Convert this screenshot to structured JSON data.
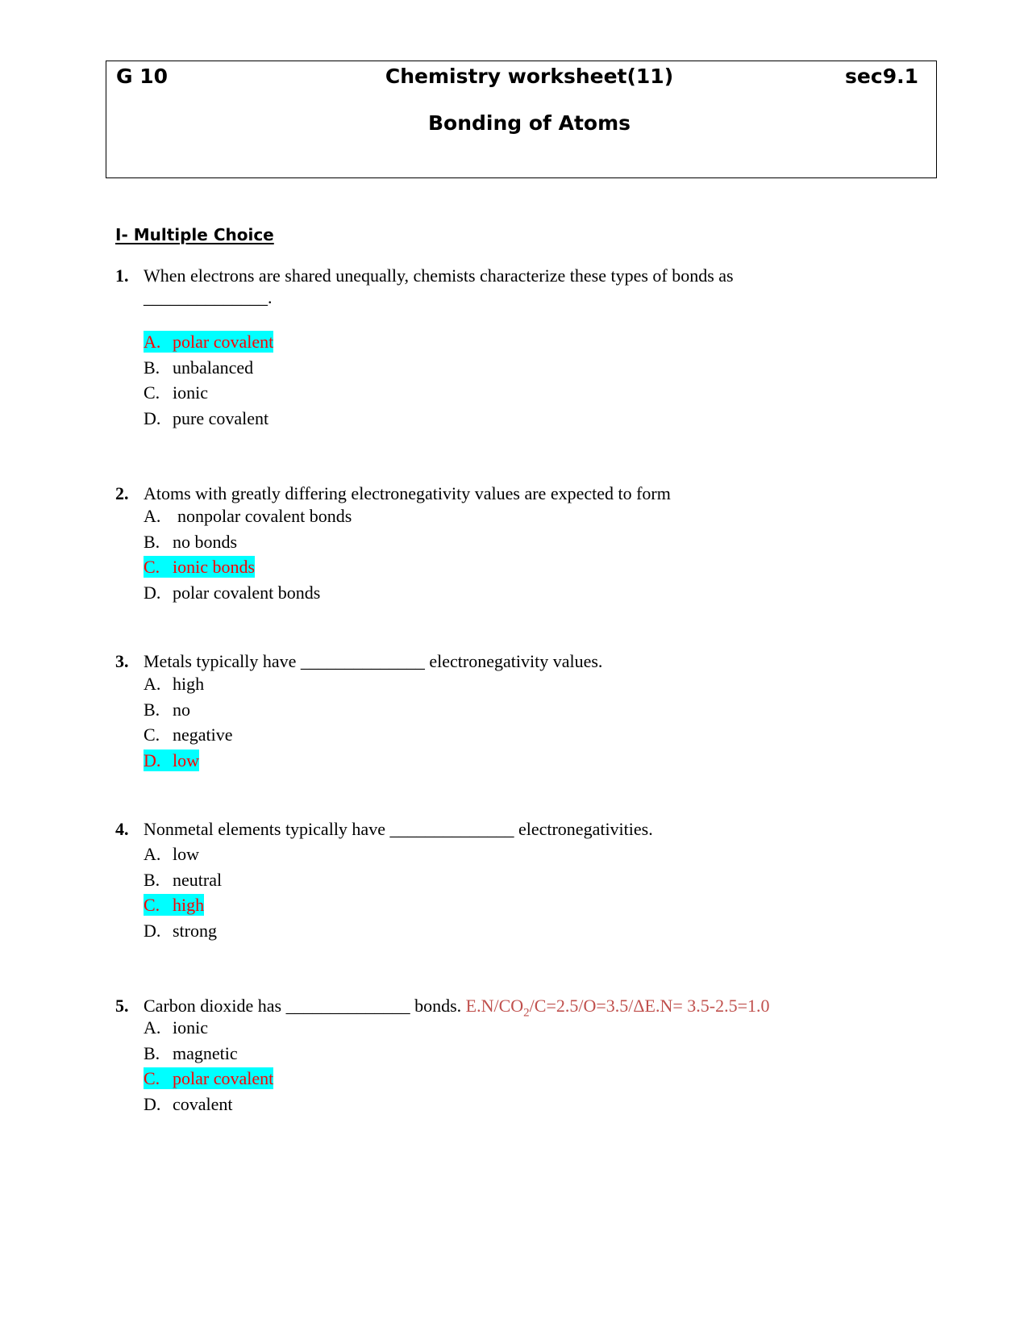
{
  "header": {
    "grade": "G 10",
    "title": "Chemistry worksheet(11)",
    "section": "sec9.1",
    "subtitle": "Bonding of Atoms"
  },
  "section_title": "I- Multiple Choice",
  "colors": {
    "highlight": "#00ffff",
    "answer_text": "#ff0000",
    "note_text": "#c0504d"
  },
  "questions": [
    {
      "number": "1.",
      "stem": "When electrons are shared unequally, chemists characterize these types of bonds as",
      "stem_continued": "______________.",
      "options": [
        {
          "letter": "A.",
          "text": "polar covalent",
          "correct": true
        },
        {
          "letter": "B.",
          "text": "unbalanced",
          "correct": false
        },
        {
          "letter": "C.",
          "text": "ionic",
          "correct": false
        },
        {
          "letter": "D.",
          "text": "pure covalent",
          "correct": false
        }
      ]
    },
    {
      "number": "2.",
      "stem": "Atoms with greatly differing electronegativity values are expected to form",
      "options": [
        {
          "letter": "A.",
          "text": "nonpolar covalent bonds",
          "correct": false
        },
        {
          "letter": "B.",
          "text": "no bonds",
          "correct": false
        },
        {
          "letter": "C.",
          "text": "ionic bonds",
          "correct": true
        },
        {
          "letter": "D.",
          "text": "polar covalent bonds",
          "correct": false
        }
      ]
    },
    {
      "number": "3.",
      "stem": "Metals typically have ______________ electronegativity values.",
      "options": [
        {
          "letter": "A.",
          "text": "high",
          "correct": false
        },
        {
          "letter": "B.",
          "text": "no",
          "correct": false
        },
        {
          "letter": "C.",
          "text": "negative",
          "correct": false
        },
        {
          "letter": "D.",
          "text": "low",
          "correct": true
        }
      ]
    },
    {
      "number": "4.",
      "stem": "Nonmetal elements typically have ______________ electronegativities.",
      "options": [
        {
          "letter": "A.",
          "text": "low",
          "correct": false
        },
        {
          "letter": "B.",
          "text": "neutral",
          "correct": false
        },
        {
          "letter": "C.",
          "text": "high",
          "correct": true
        },
        {
          "letter": "D.",
          "text": "strong",
          "correct": false
        }
      ]
    },
    {
      "number": "5.",
      "stem": "Carbon dioxide has ______________ bonds.",
      "note_prefix": "E.N/CO",
      "note_subscript": "2",
      "note_suffix": "/C=2.5/O=3.5/ΔE.N= 3.5-2.5=1.0",
      "options": [
        {
          "letter": "A.",
          "text": "ionic",
          "correct": false
        },
        {
          "letter": "B.",
          "text": "magnetic",
          "correct": false
        },
        {
          "letter": "C.",
          "text": "polar covalent",
          "correct": true
        },
        {
          "letter": "D.",
          "text": "covalent",
          "correct": false
        }
      ]
    }
  ]
}
